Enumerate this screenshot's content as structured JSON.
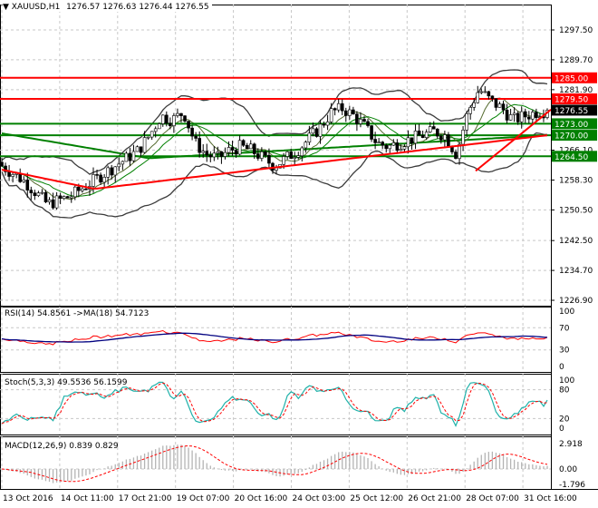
{
  "header": {
    "symbol": "XAUUSD,H1",
    "ohlc": "1276.57 1276.63 1276.44 1276.55"
  },
  "colors": {
    "bull": "#000000",
    "bear": "#000000",
    "red": "#ff0000",
    "green": "#008000",
    "bands": "#3c3c3c",
    "rsi_ma": "#000080",
    "stoch_main": "#20b2aa"
  },
  "chart_data": [
    {
      "type": "candlestick",
      "title": "XAUUSD,H1",
      "price_ticks": [
        "1297.50",
        "1289.70",
        "1281.90",
        "1266.10",
        "1258.30",
        "1250.50",
        "1242.50",
        "1234.70",
        "1226.90"
      ],
      "ylim": [
        1226.9,
        1297.5
      ],
      "time_ticks": [
        "13 Oct 2016",
        "14 Oct 11:00",
        "17 Oct 21:00",
        "19 Oct 07:00",
        "20 Oct 16:00",
        "24 Oct 03:00",
        "25 Oct 12:00",
        "26 Oct 21:00",
        "28 Oct 07:00",
        "31 Oct 16:00"
      ],
      "close_keypoints": [
        1262,
        1260,
        1258,
        1255,
        1252,
        1253,
        1254,
        1256,
        1258,
        1260,
        1262,
        1264,
        1266,
        1270,
        1275,
        1274,
        1276,
        1268,
        1265,
        1264,
        1266,
        1267,
        1266,
        1264,
        1262,
        1264,
        1266,
        1269,
        1272,
        1276,
        1277,
        1275,
        1272,
        1268,
        1267,
        1268,
        1269,
        1270,
        1271,
        1270,
        1265,
        1276,
        1282,
        1279,
        1277,
        1274,
        1275,
        1276,
        1276.55
      ],
      "horizontal_levels": [
        {
          "price": 1285.0,
          "label": "1285.00",
          "color": "#ff0000"
        },
        {
          "price": 1279.5,
          "label": "1279.50",
          "color": "#ff0000"
        },
        {
          "price": 1273.0,
          "label": "1273.00",
          "color": "#008000"
        },
        {
          "price": 1270.0,
          "label": "1270.00",
          "color": "#008000"
        },
        {
          "price": 1264.5,
          "label": "1264.50",
          "color": "#008000"
        }
      ],
      "current_price": {
        "label": "1276.55",
        "price": 1276.55
      },
      "trendline": {
        "from_price": 1260.7,
        "to_price": 1276.7,
        "color": "#ff0000"
      }
    },
    {
      "type": "line",
      "title": "RSI(14) 54.8561  ->MA(18) 54.7123",
      "ticks": [
        "100",
        "70",
        "30",
        "0"
      ],
      "ylim": [
        0,
        100
      ]
    },
    {
      "type": "line",
      "title": "Stoch(5,3,3) 49.5536 56.1599",
      "ticks": [
        "100",
        "80",
        "20",
        "0"
      ],
      "ylim": [
        0,
        100
      ]
    },
    {
      "type": "bar",
      "title": "MACD(12,26,9) 0.839 0.829",
      "ticks": [
        "2.918",
        "0.00",
        "-1.796"
      ],
      "ylim": [
        -1.796,
        2.918
      ]
    }
  ]
}
